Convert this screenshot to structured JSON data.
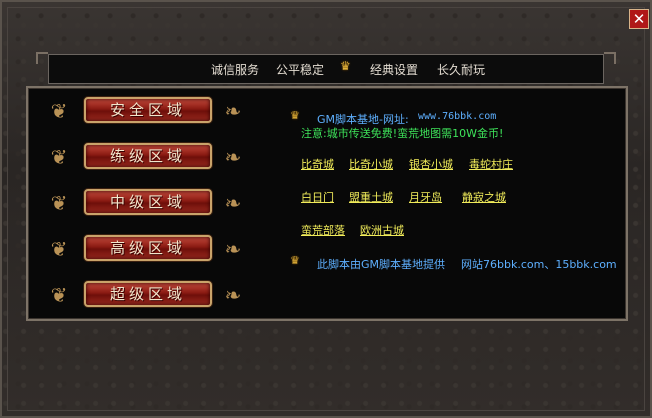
{
  "window": {
    "close_label": "✕"
  },
  "menu": {
    "items": [
      "诚信服务",
      "公平稳定",
      "经典设置",
      "长久耐玩"
    ]
  },
  "zones": [
    "安全区域",
    "练级区域",
    "中级区域",
    "高级区域",
    "超级区域"
  ],
  "info": {
    "site_label": "GM脚本基地-网址:",
    "site_url": "www.76bbk.com",
    "notice": "注意:城市传送免费!蛮荒地图需10W金币!",
    "links": [
      [
        "比奇城",
        "比奇小城",
        "银杏小城",
        "毒蛇村庄"
      ],
      [
        "白日门",
        "盟重土城",
        "月牙岛",
        "静寂之城"
      ],
      [
        "蛮荒部落",
        "欧洲古城"
      ]
    ],
    "footer_label": "此脚本由GM脚本基地提供",
    "footer_sites": "网站76bbk.com、15bbk.com"
  },
  "colors": {
    "link": "#f1ec5a",
    "info": "#5eb0ff",
    "notice": "#3ee35a"
  },
  "icons": {
    "crown": "crown-icon",
    "ornament": "scroll-ornament-icon",
    "close": "close-icon"
  }
}
